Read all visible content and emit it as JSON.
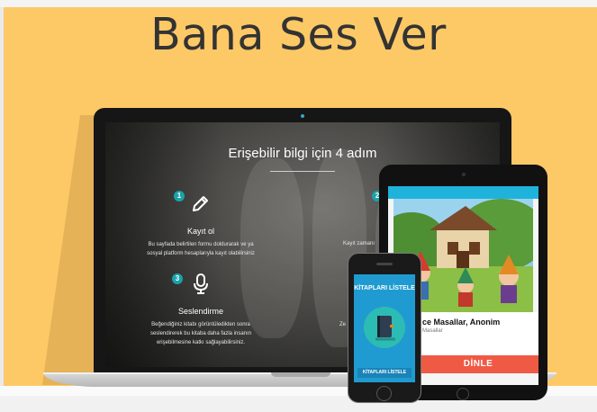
{
  "page": {
    "title": "Bana Ses Ver"
  },
  "laptop": {
    "heading": "Erişebilir bilgi için 4 adım",
    "steps": [
      {
        "number": "1",
        "icon": "pencil-icon",
        "title": "Kayıt ol",
        "desc_line1": "Bu sayfada belirtilen formu doldurarak ve ya",
        "desc_line2": "sosyal platform hesaplarıyla kayıt olabilirsiniz"
      },
      {
        "number": "2",
        "desc_partial": "Kayıt zamanı"
      },
      {
        "number": "3",
        "icon": "microphone-icon",
        "title": "Seslendirme",
        "desc_line1": "Beğendiğiniz kitabı görüntüledikten sonra",
        "desc_line2": "seslendirerek bu kitaba daha fazla insanın",
        "desc_line3": "erişebilmesine katkı sağlayabilirsiniz."
      },
      {
        "desc_partial": "Ze"
      }
    ]
  },
  "tablet": {
    "book_title": "ce Masallar, Anonim",
    "book_subtitle": "Masallar",
    "listen_button": "DİNLE",
    "colors": {
      "header": "#1fb3dc",
      "button": "#ef5a44"
    }
  },
  "phone": {
    "title": "KİTAPLARI LİSTELE",
    "button": "KİTAPLARI LİSTELE",
    "icon": "notebook-icon",
    "colors": {
      "screen": "#1f9bd1",
      "circle": "#2dbcb3"
    }
  },
  "colors": {
    "background": "#fdc966",
    "accent": "#19a3a8"
  }
}
